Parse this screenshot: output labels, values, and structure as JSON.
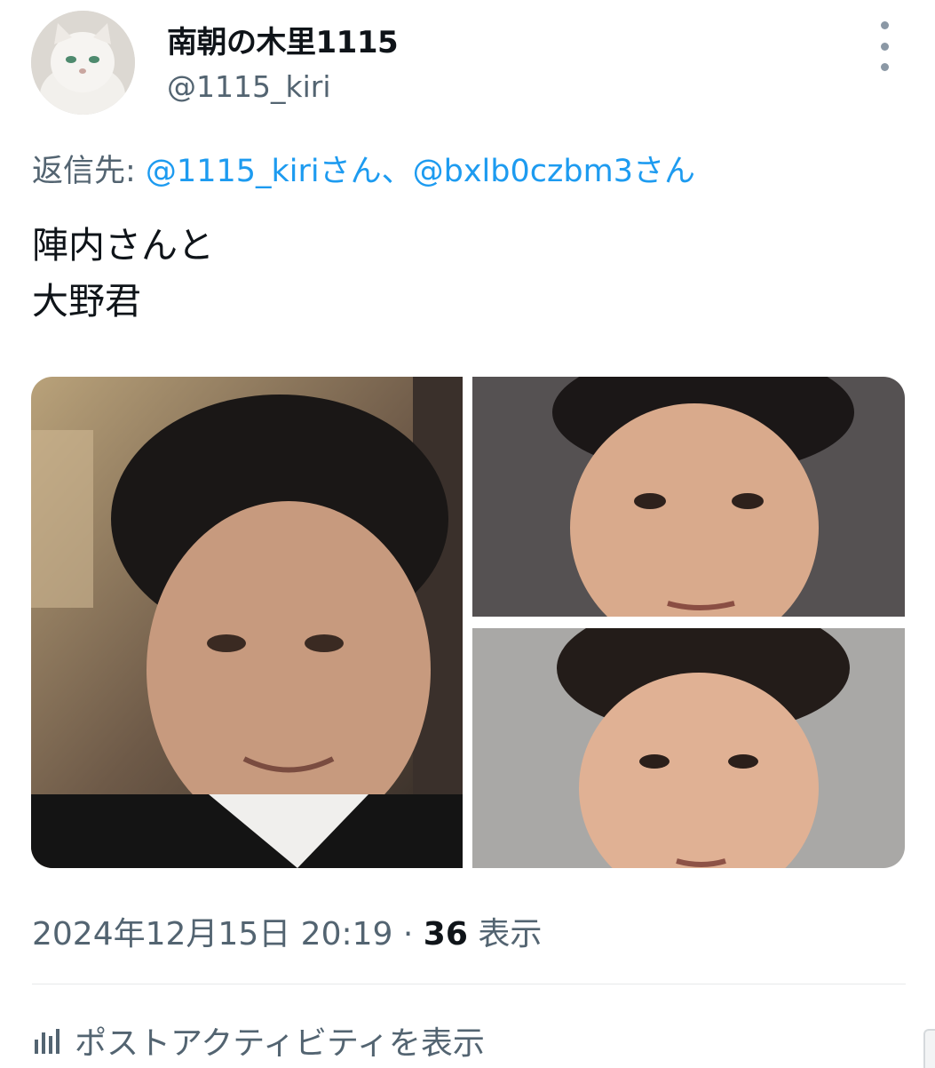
{
  "tweet": {
    "display_name": "南朝の木里1115",
    "handle": "@1115_kiri",
    "reply_prefix": "返信先: ",
    "reply_mention_1": "@1115_kiriさん",
    "reply_separator": "、",
    "reply_mention_2": "@bxlb0czbm3さん",
    "text_line_1": "陣内さんと",
    "text_line_2": "大野君",
    "timestamp": "2024年12月15日 20:19",
    "separator_dot": " · ",
    "views_count": "36",
    "views_label": " 表示",
    "activity_label": "ポストアクティビティを表示"
  },
  "icons": {
    "more": "more-vertical-icon",
    "analytics": "analytics-bars-icon"
  },
  "colors": {
    "link": "#1d9bf0",
    "secondary_text": "#536471",
    "primary_text": "#0f1419"
  }
}
